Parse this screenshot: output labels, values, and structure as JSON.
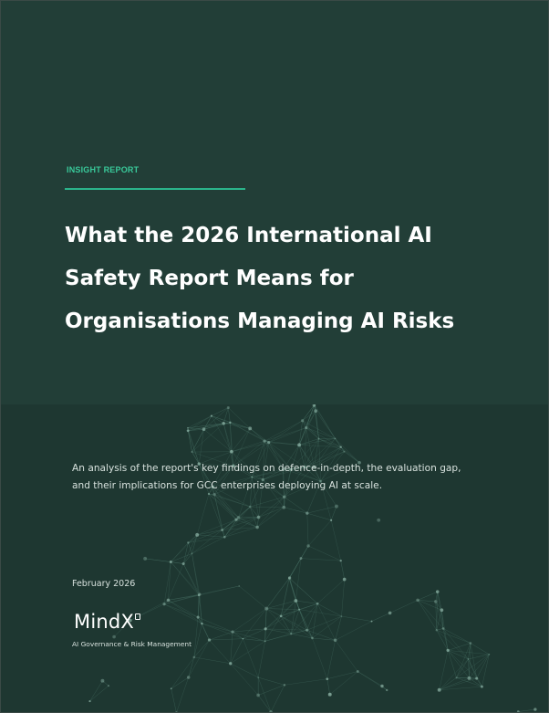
{
  "eyebrow": "INSIGHT REPORT",
  "title_lines": [
    "What the 2026 International AI",
    "Safety Report Means for",
    "Organisations Managing AI Risks"
  ],
  "subtitle_lines": [
    "An analysis of the report's key findings on defence-in-depth, the evaluation gap,",
    "and their implications for GCC enterprises deploying AI at scale."
  ],
  "date": "February 2026",
  "brand": {
    "name": "MindX",
    "tagline": "AI Governance & Risk Management"
  },
  "colors": {
    "background": "#223e37",
    "lower_background": "#1e3731",
    "accent": "#2bb58b",
    "eyebrow": "#39c99a",
    "title": "#ffffff",
    "body_text": "#d8e2de",
    "network_lines": "#4e7a6d"
  }
}
